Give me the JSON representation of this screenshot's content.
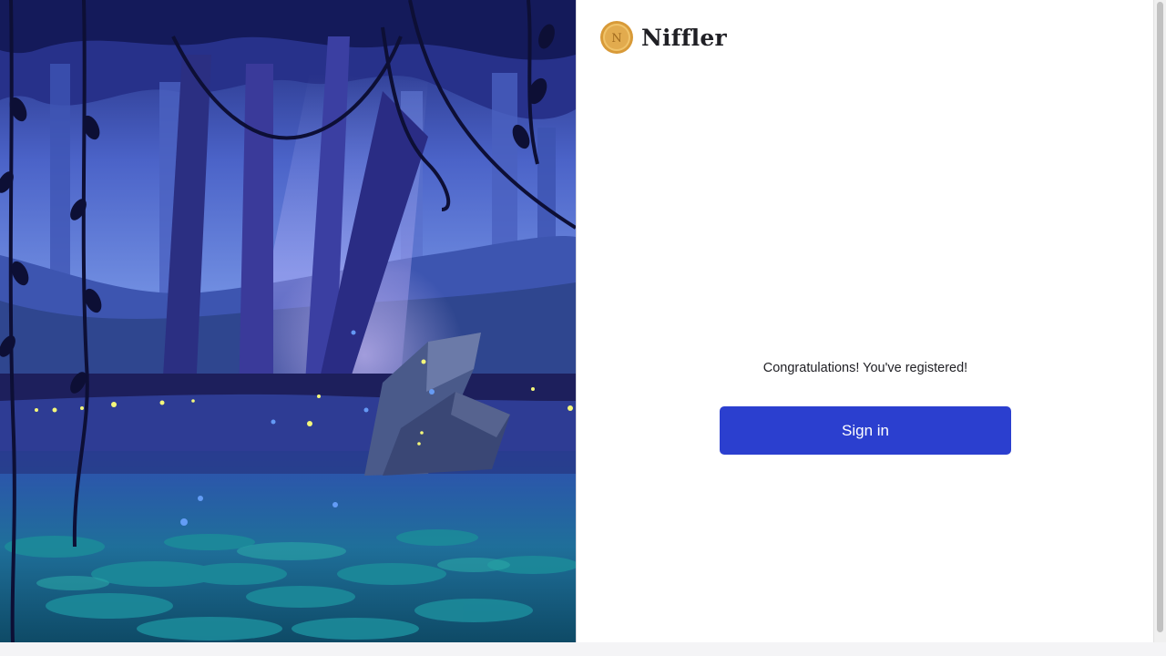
{
  "brand": {
    "name": "Niffler",
    "coin_letter": "N"
  },
  "register_result": {
    "message": "Congratulations! You've registered!",
    "signin_label": "Sign in"
  },
  "colors": {
    "primary_button": "#2b3fcf",
    "coin_gold": "#e2ab4e"
  },
  "icons": {
    "logo": "gold-coin-icon"
  }
}
